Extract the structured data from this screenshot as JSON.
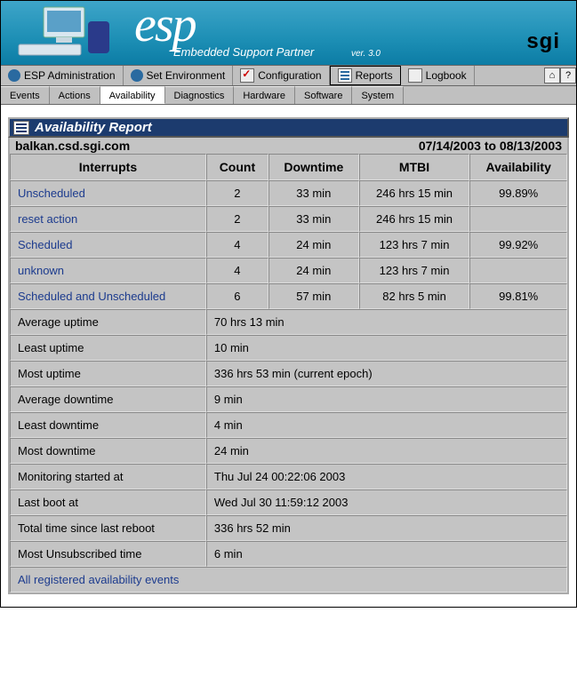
{
  "banner": {
    "logo": "esp",
    "subtitle": "Embedded Support Partner",
    "version": "ver. 3.0",
    "brand": "sgi"
  },
  "toolbar": [
    {
      "label": "ESP Administration",
      "icon": "round"
    },
    {
      "label": "Set Environment",
      "icon": "round"
    },
    {
      "label": "Configuration",
      "icon": "check"
    },
    {
      "label": "Reports",
      "icon": "list",
      "selected": true
    },
    {
      "label": "Logbook",
      "icon": "book"
    }
  ],
  "tabs": [
    {
      "label": "Events"
    },
    {
      "label": "Actions"
    },
    {
      "label": "Availability",
      "selected": true
    },
    {
      "label": "Diagnostics"
    },
    {
      "label": "Hardware"
    },
    {
      "label": "Software"
    },
    {
      "label": "System"
    }
  ],
  "report": {
    "title": "Availability Report",
    "host": "balkan.csd.sgi.com",
    "date_range": "07/14/2003 to 08/13/2003",
    "headers": {
      "c0": "Interrupts",
      "c1": "Count",
      "c2": "Downtime",
      "c3": "MTBI",
      "c4": "Availability"
    },
    "rows": [
      {
        "label": "Unscheduled",
        "link": true,
        "count": "2",
        "down": "33 min",
        "mtbi": "246 hrs 15 min",
        "avail": "99.89%"
      },
      {
        "label": "reset action",
        "link": true,
        "indent": true,
        "count": "2",
        "down": "33 min",
        "mtbi": "246 hrs 15 min",
        "avail": ""
      },
      {
        "label": "Scheduled",
        "link": true,
        "count": "4",
        "down": "24 min",
        "mtbi": "123 hrs 7 min",
        "avail": "99.92%"
      },
      {
        "label": "unknown",
        "link": true,
        "indent": true,
        "count": "4",
        "down": "24 min",
        "mtbi": "123 hrs 7 min",
        "avail": ""
      },
      {
        "label": "Scheduled and Unscheduled",
        "link": true,
        "count": "6",
        "down": "57 min",
        "mtbi": "82 hrs 5 min",
        "avail": "99.81%"
      }
    ],
    "summary": [
      {
        "label": "Average uptime",
        "value": "70 hrs 13 min"
      },
      {
        "label": "Least uptime",
        "value": "10 min"
      },
      {
        "label": "Most uptime",
        "value": "336 hrs 53 min  (current epoch)"
      },
      {
        "label": "Average downtime",
        "value": "9 min"
      },
      {
        "label": "Least downtime",
        "value": "4 min"
      },
      {
        "label": "Most downtime",
        "value": "24 min"
      },
      {
        "label": "Monitoring started at",
        "value": "Thu Jul 24 00:22:06 2003"
      },
      {
        "label": "Last boot at",
        "value": "Wed Jul 30 11:59:12 2003"
      },
      {
        "label": "Total time since last reboot",
        "value": "336 hrs 52 min"
      },
      {
        "label": "Most Unsubscribed time",
        "value": "6 min"
      }
    ],
    "footer_link": "All registered availability events"
  }
}
